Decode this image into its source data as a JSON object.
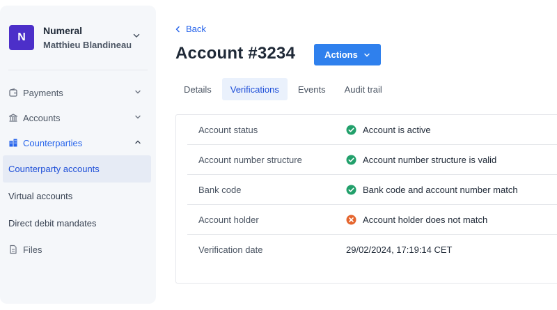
{
  "org": {
    "logo_letter": "N",
    "name": "Numeral",
    "user": "Matthieu Blandineau"
  },
  "sidebar": {
    "items": [
      {
        "label": "Payments",
        "icon": "wallet-icon"
      },
      {
        "label": "Accounts",
        "icon": "bank-icon"
      },
      {
        "label": "Counterparties",
        "icon": "building-icon"
      }
    ],
    "sub_items": [
      {
        "label": "Counterparty accounts"
      },
      {
        "label": "Virtual accounts"
      },
      {
        "label": "Direct debit mandates"
      }
    ],
    "files": {
      "label": "Files",
      "icon": "file-icon"
    }
  },
  "header": {
    "back_label": "Back",
    "title": "Account #3234",
    "actions_label": "Actions"
  },
  "tabs": [
    {
      "label": "Details"
    },
    {
      "label": "Verifications"
    },
    {
      "label": "Events"
    },
    {
      "label": "Audit trail"
    }
  ],
  "verifications": [
    {
      "label": "Account status",
      "value": "Account is active",
      "status": "success"
    },
    {
      "label": "Account number structure",
      "value": "Account number structure is valid",
      "status": "success"
    },
    {
      "label": "Bank code",
      "value": "Bank code and account number match",
      "status": "success"
    },
    {
      "label": "Account holder",
      "value": "Account holder does not match",
      "status": "failure"
    },
    {
      "label": "Verification date",
      "value": "29/02/2024, 17:19:14 CET",
      "status": "none"
    }
  ],
  "colors": {
    "accent": "#2f80ed",
    "logo": "#4c2fc9",
    "success": "#22a06b",
    "failure": "#e5662f"
  }
}
